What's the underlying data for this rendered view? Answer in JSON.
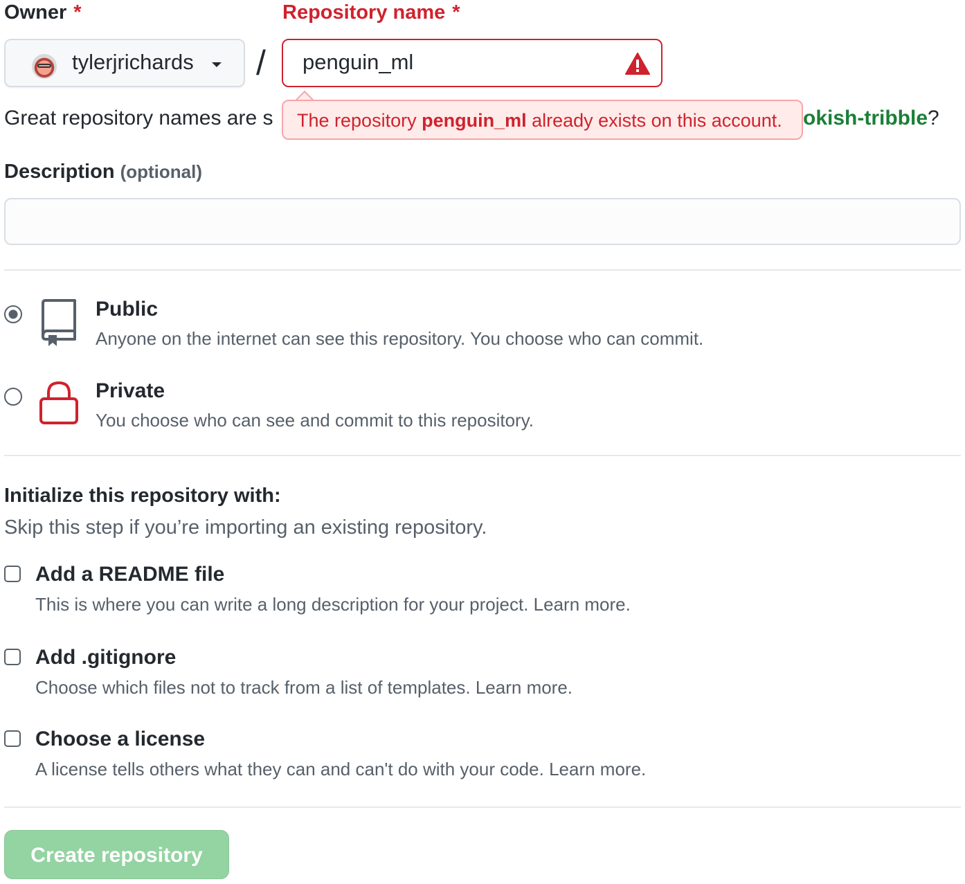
{
  "owner": {
    "label": "Owner",
    "required_mark": "*",
    "selected": "tylerjrichards",
    "avatar_icon": "user-avatar-icon",
    "caret_icon": "chevron-down-icon"
  },
  "separator": "/",
  "repository_name": {
    "label": "Repository name",
    "required_mark": "*",
    "value": "penguin_ml",
    "status_icon": "alert-icon",
    "error_color": "#cf222e"
  },
  "error_tooltip": {
    "prefix": "The repository ",
    "name": "penguin_ml",
    "suffix": " already exists on this account."
  },
  "name_hint": {
    "visible_start": "Great repository names are s",
    "suggestion_visible_end": "okish-tribble",
    "end": "?"
  },
  "description": {
    "label": "Description",
    "optional": "(optional)",
    "value": ""
  },
  "visibility": {
    "options": [
      {
        "id": "public",
        "title": "Public",
        "description": "Anyone on the internet can see this repository. You choose who can commit.",
        "icon": "repo-icon",
        "checked": true
      },
      {
        "id": "private",
        "title": "Private",
        "description": "You choose who can see and commit to this repository.",
        "icon": "lock-icon",
        "checked": false
      }
    ]
  },
  "initialize": {
    "heading": "Initialize this repository with:",
    "subheading": "Skip this step if you’re importing an existing repository.",
    "options": [
      {
        "title": "Add a README file",
        "description": "This is where you can write a long description for your project.",
        "link": "Learn more.",
        "checked": false
      },
      {
        "title": "Add .gitignore",
        "description": "Choose which files not to track from a list of templates.",
        "link": "Learn more.",
        "checked": false
      },
      {
        "title": "Choose a license",
        "description": "A license tells others what they can and can't do with your code.",
        "link": "Learn more.",
        "checked": false
      }
    ]
  },
  "submit": {
    "label": "Create repository",
    "enabled": false,
    "color": "#94d3a2"
  }
}
